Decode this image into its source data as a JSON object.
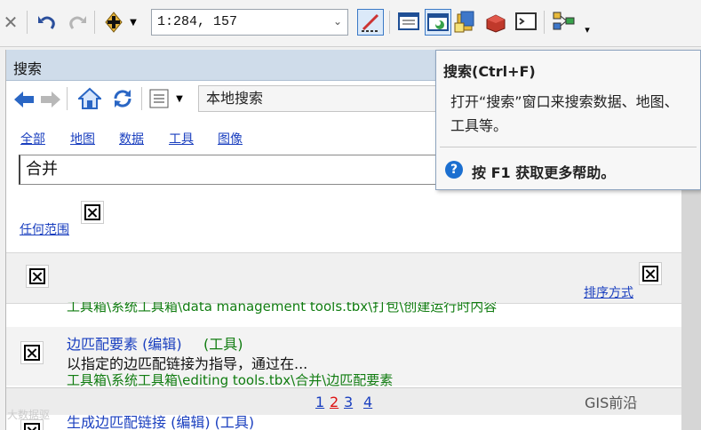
{
  "toolbar": {
    "scale_value": "1:284, 157",
    "icons": [
      "close-icon",
      "undo-icon",
      "redo-icon",
      "add-data-icon",
      "dropdown-icon",
      "editor-icon",
      "table-of-contents-icon",
      "search-window-icon",
      "catalog-icon",
      "arctoolbox-icon",
      "python-icon",
      "modelbuilder-icon",
      "overflow-icon"
    ]
  },
  "search_panel": {
    "title": "搜索",
    "location": "本地搜索",
    "filters": [
      "全部",
      "地图",
      "数据",
      "工具",
      "图像"
    ],
    "query": "合并",
    "scope_link": "任何范围",
    "sort_link": "排序方式",
    "results": [
      {
        "path": "工具箱\\系统工具箱\\data management tools.tbx\\打包\\创建运行时内容"
      },
      {
        "title": "边匹配要素 (编辑)",
        "kind": "(工具)",
        "description": "以指定的边匹配链接为指导，通过在...",
        "path": "工具箱\\系统工具箱\\editing tools.tbx\\合并\\边匹配要素"
      },
      {
        "title": "生成边匹配链接 (编辑) (工具)"
      }
    ],
    "pages": [
      "1",
      "2",
      "3",
      "4"
    ],
    "current_page": "2"
  },
  "tooltip": {
    "title": "搜索(Ctrl+F)",
    "body": "打开“搜索”窗口来搜索数据、地图、工具等。",
    "help": "按 F1 获取更多帮助。"
  },
  "watermarks": {
    "left": "大数据驱",
    "right": "GIS前沿"
  },
  "colors": {
    "link": "#1a3fbf",
    "path_green": "#107c10",
    "accent": "#1b6fd0",
    "page_current": "#d11"
  }
}
